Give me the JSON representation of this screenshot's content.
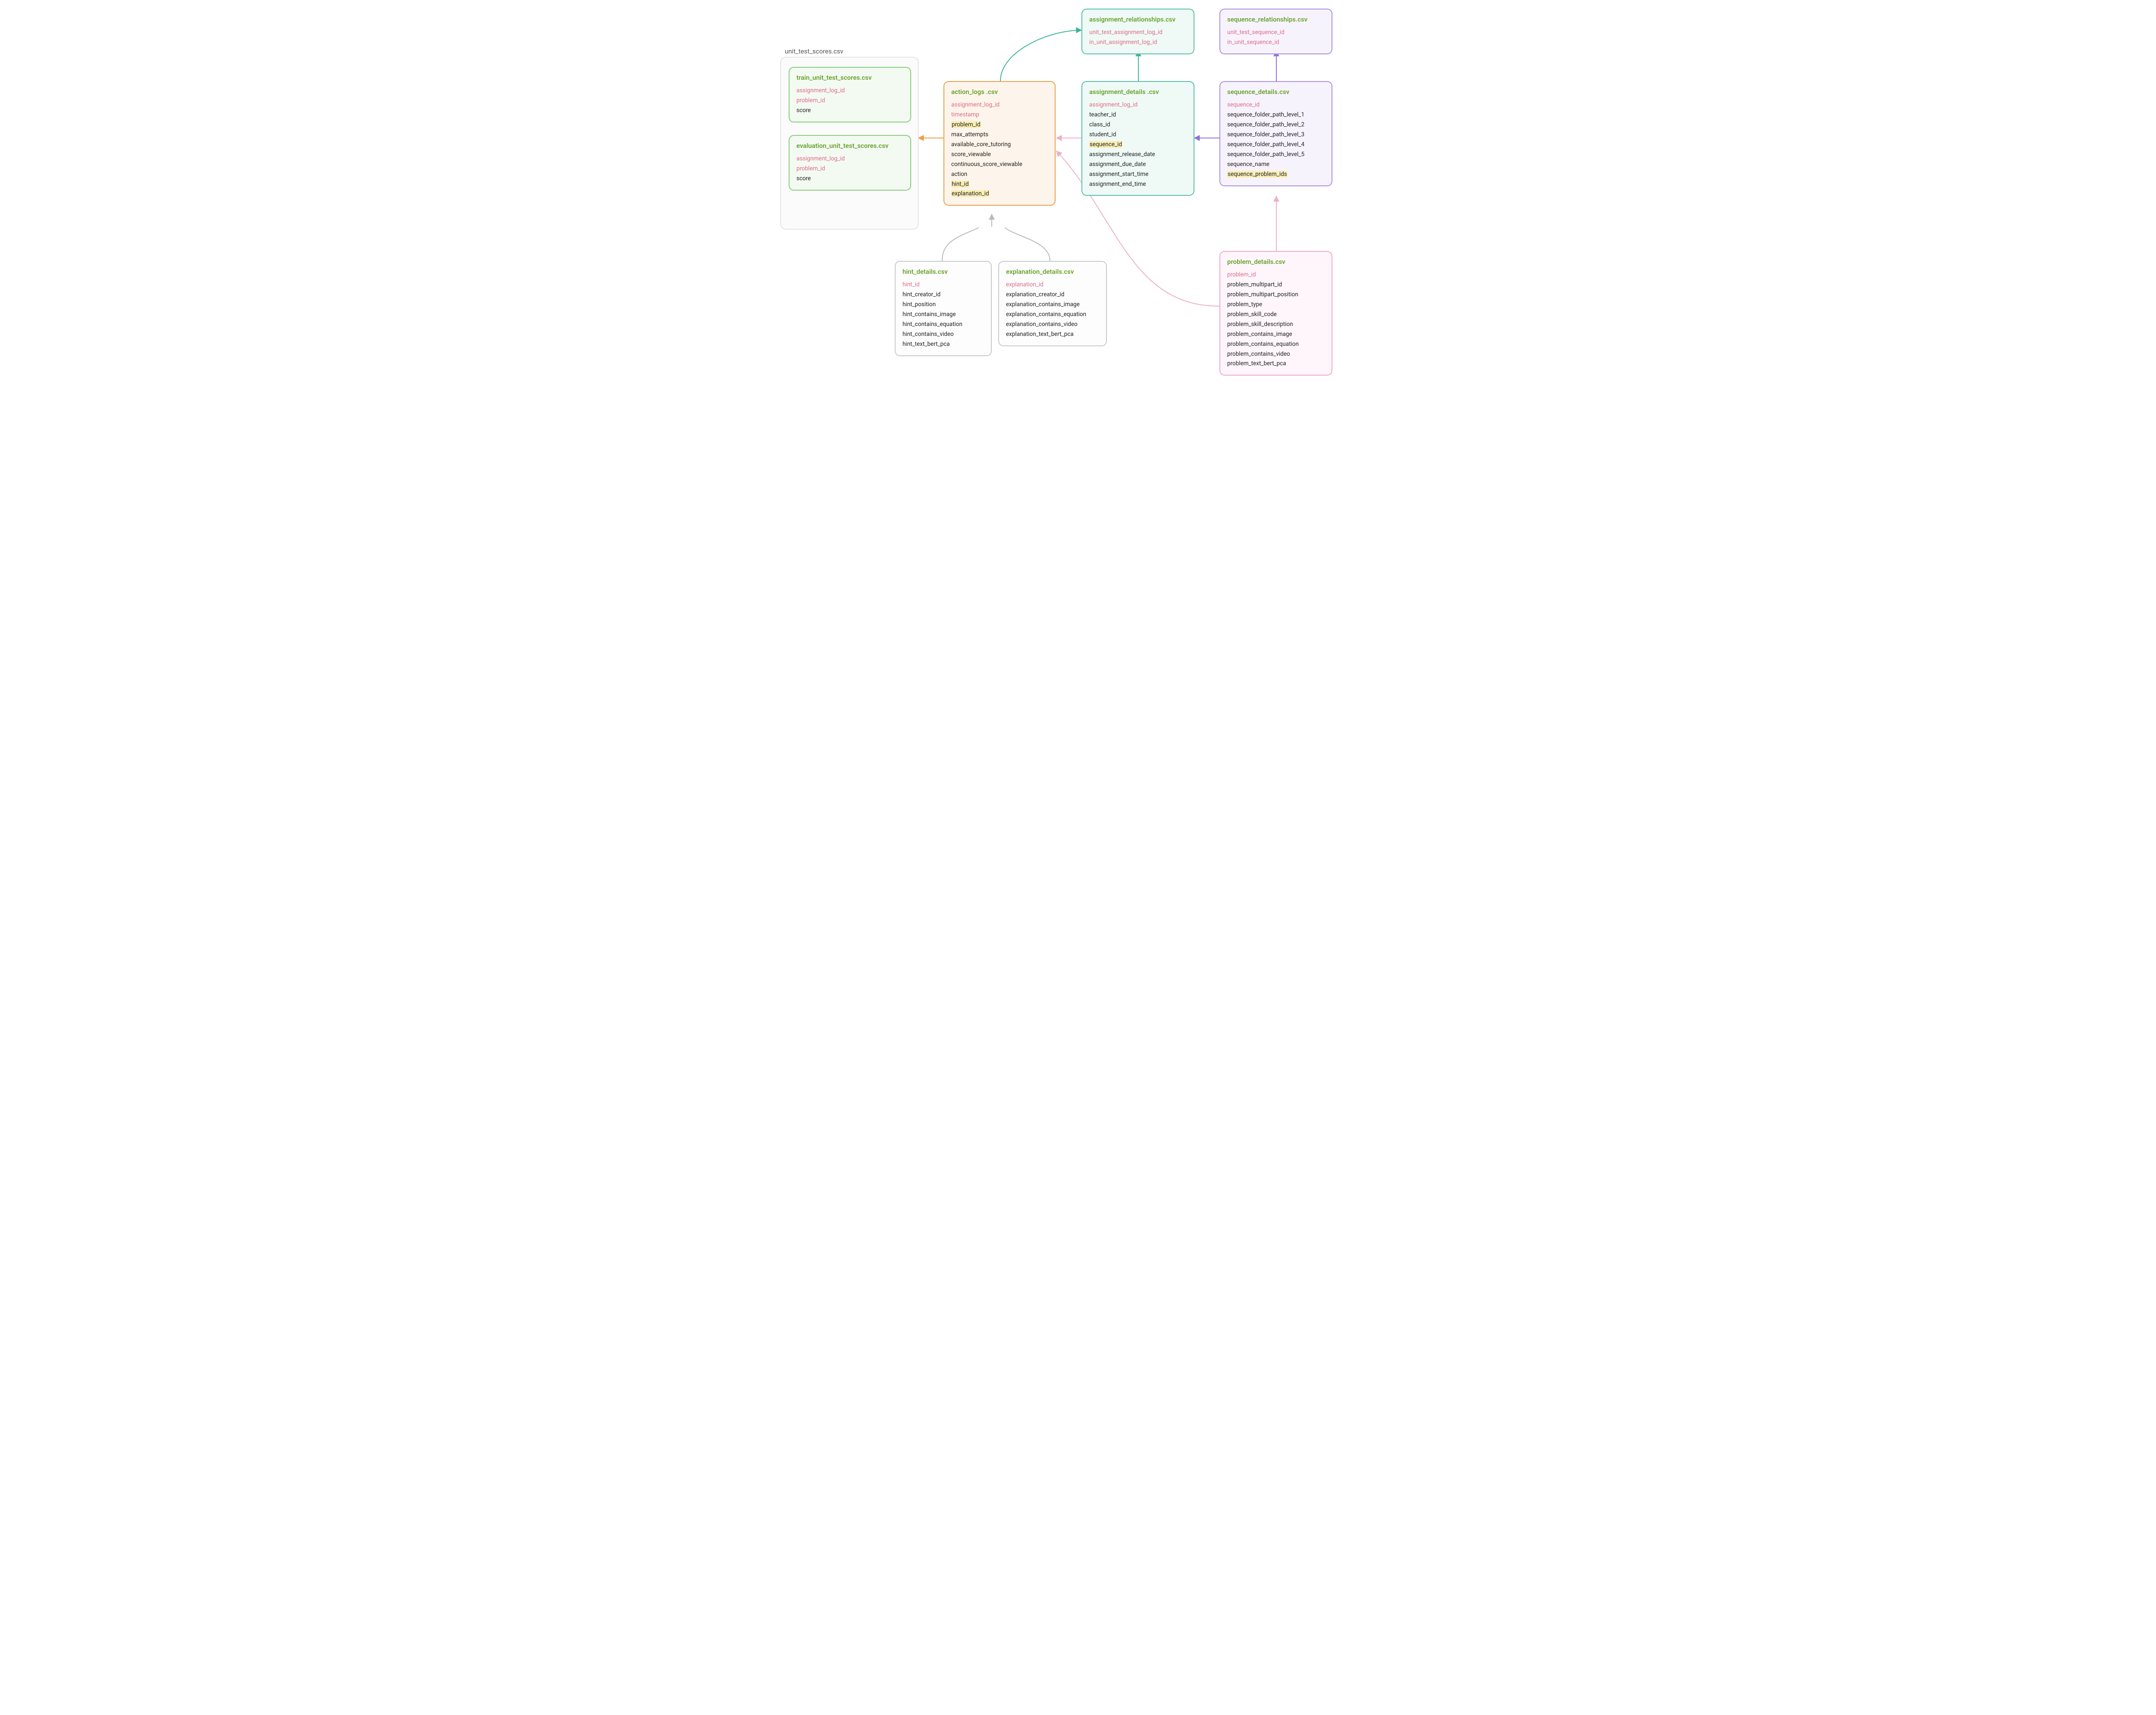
{
  "container": {
    "label": "unit_test_scores.csv"
  },
  "train_scores": {
    "title": "train_unit_test_scores.csv",
    "fields": [
      {
        "text": "assignment_log_id",
        "key": true
      },
      {
        "text": "problem_id",
        "key": true
      },
      {
        "text": "score"
      }
    ]
  },
  "eval_scores": {
    "title": "evaluation_unit_test_scores.csv",
    "fields": [
      {
        "text": "assignment_log_id",
        "key": true
      },
      {
        "text": "problem_id",
        "key": true
      },
      {
        "text": "score"
      }
    ]
  },
  "action_logs": {
    "title": "action_logs .csv",
    "fields": [
      {
        "text": "assignment_log_id",
        "key": true
      },
      {
        "text": "timestamp",
        "key": true
      },
      {
        "text": "problem_id",
        "hl": true
      },
      {
        "text": "max_attempts"
      },
      {
        "text": "available_core_tutoring"
      },
      {
        "text": "score_viewable"
      },
      {
        "text": "continuous_score_viewable"
      },
      {
        "text": "action"
      },
      {
        "text": "hint_id",
        "hl": true
      },
      {
        "text": "explanation_id",
        "hl": true
      }
    ]
  },
  "assignment_rel": {
    "title": "assignment_relationships.csv",
    "fields": [
      {
        "text": "unit_test_assignment_log_id",
        "key": true
      },
      {
        "text": "in_unit_assignment_log_id",
        "key": true
      }
    ]
  },
  "sequence_rel": {
    "title": "sequence_relationships.csv",
    "fields": [
      {
        "text": "unit_test_sequence_id",
        "key": true
      },
      {
        "text": "in_unit_sequence_id",
        "key": true
      }
    ]
  },
  "assignment_details": {
    "title": "assignment_details .csv",
    "fields": [
      {
        "text": "assignment_log_id",
        "key": true
      },
      {
        "text": "teacher_id"
      },
      {
        "text": "class_id"
      },
      {
        "text": "student_id"
      },
      {
        "text": "sequence_id",
        "hl": true
      },
      {
        "text": "assignment_release_date"
      },
      {
        "text": "assignment_due_date"
      },
      {
        "text": "assignment_start_time"
      },
      {
        "text": "assignment_end_time"
      }
    ]
  },
  "sequence_details": {
    "title": "sequence_details.csv",
    "fields": [
      {
        "text": "sequence_id",
        "key": true
      },
      {
        "text": "sequence_folder_path_level_1"
      },
      {
        "text": "sequence_folder_path_level_2"
      },
      {
        "text": "sequence_folder_path_level_3"
      },
      {
        "text": "sequence_folder_path_level_4"
      },
      {
        "text": "sequence_folder_path_level_5"
      },
      {
        "text": "sequence_name"
      },
      {
        "text": "sequence_problem_ids",
        "hl": true
      }
    ]
  },
  "hint_details": {
    "title": "hint_details.csv",
    "fields": [
      {
        "text": "hint_id",
        "key": true
      },
      {
        "text": "hint_creator_id"
      },
      {
        "text": "hint_position"
      },
      {
        "text": "hint_contains_image"
      },
      {
        "text": "hint_contains_equation"
      },
      {
        "text": "hint_contains_video"
      },
      {
        "text": "hint_text_bert_pca"
      }
    ]
  },
  "explanation_details": {
    "title": "explanation_details.csv",
    "fields": [
      {
        "text": "explanation_id",
        "key": true
      },
      {
        "text": "explanation_creator_id"
      },
      {
        "text": "explanation_contains_image"
      },
      {
        "text": "explanation_contains_equation"
      },
      {
        "text": "explanation_contains_video"
      },
      {
        "text": "explanation_text_bert_pca"
      }
    ]
  },
  "problem_details": {
    "title": "problem_details.csv",
    "fields": [
      {
        "text": "problem_id",
        "key": true
      },
      {
        "text": "problem_multipart_id"
      },
      {
        "text": "problem_multipart_position"
      },
      {
        "text": "problem_type"
      },
      {
        "text": "problem_skill_code"
      },
      {
        "text": "problem_skill_description"
      },
      {
        "text": "problem_contains_image"
      },
      {
        "text": "problem_contains_equation"
      },
      {
        "text": "problem_contains_video"
      },
      {
        "text": "problem_text_bert_pca"
      }
    ]
  }
}
